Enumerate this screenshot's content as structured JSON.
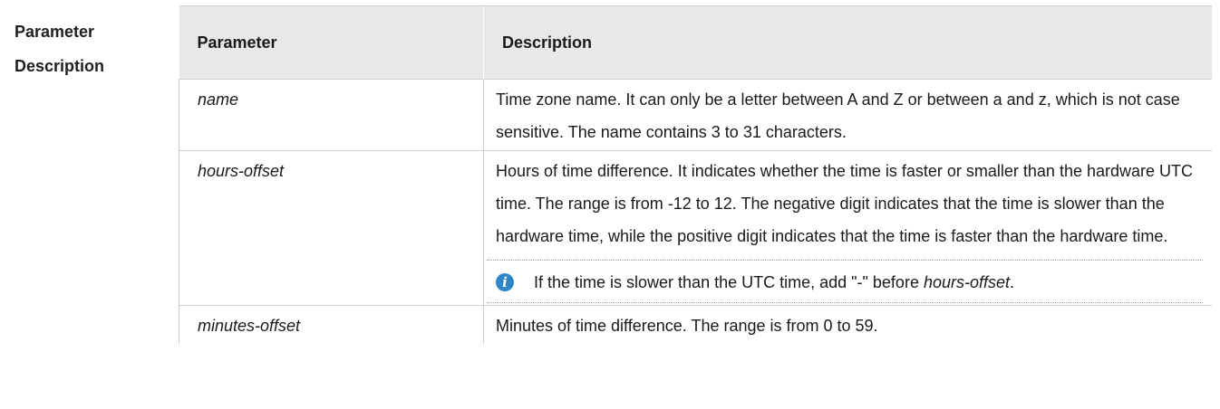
{
  "section_label": {
    "line1": "Parameter",
    "line2": "Description"
  },
  "table": {
    "headers": [
      "Parameter",
      "Description"
    ],
    "rows": [
      {
        "name": "name",
        "description": "Time zone name. It can only be a letter between A and Z or between a and z, which is not case sensitive. The name contains 3 to 31 characters."
      },
      {
        "name": "hours-offset",
        "description": "Hours of time difference. It indicates whether the time is faster or smaller than the hardware UTC time. The range is from -12 to 12. The negative digit indicates that the time is slower than the hardware time, while the positive digit indicates that the time is faster than the hardware time.",
        "note": {
          "icon": "info-icon",
          "text_before": "If the time is slower than the UTC time, add \"-\" before ",
          "text_em": "hours-offset",
          "text_after": "."
        }
      },
      {
        "name": "minutes-offset",
        "description": "Minutes of time difference. The range is from 0 to 59."
      }
    ]
  },
  "colors": {
    "header_bg": "#e8e8e8",
    "info_icon": "#2e86c9"
  }
}
